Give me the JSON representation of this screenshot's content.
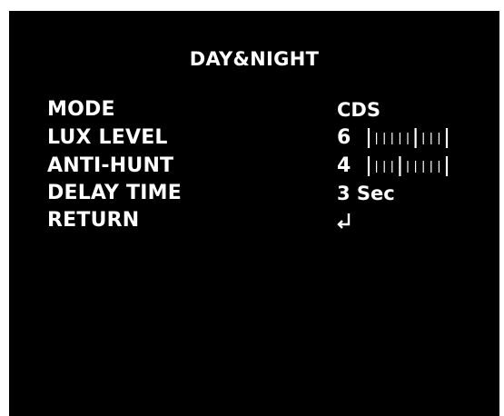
{
  "menu": {
    "title": "DAY&NIGHT",
    "items": [
      {
        "label": "MODE",
        "value": "CDS"
      },
      {
        "label": "LUX LEVEL",
        "value": "6",
        "level": 6,
        "level_max": 10
      },
      {
        "label": "ANTI-HUNT",
        "value": "4",
        "level": 4,
        "level_max": 10
      },
      {
        "label": "DELAY TIME",
        "value": "3 Sec"
      },
      {
        "label": "RETURN",
        "value_icon": "return-arrow-icon"
      }
    ]
  },
  "colors": {
    "background": "#000000",
    "text": "#ffffff",
    "frame": "#ffffff"
  }
}
